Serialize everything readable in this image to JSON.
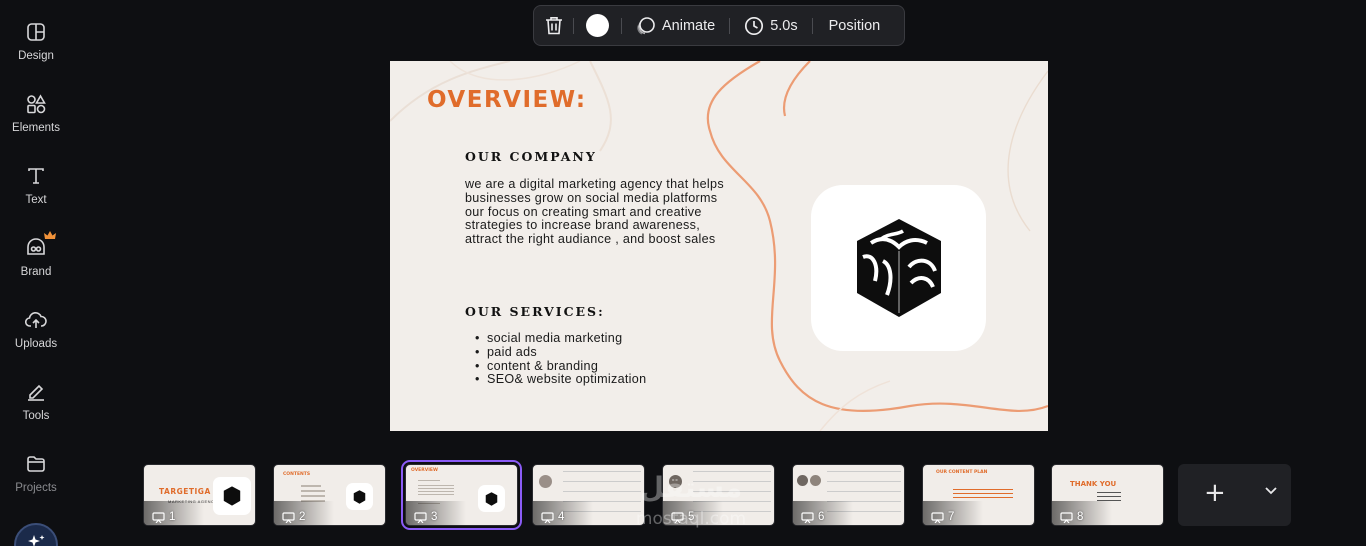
{
  "sidebar": {
    "items": [
      {
        "label": "Design",
        "icon": "design-icon"
      },
      {
        "label": "Elements",
        "icon": "elements-icon"
      },
      {
        "label": "Text",
        "icon": "text-icon"
      },
      {
        "label": "Brand",
        "icon": "brand-icon"
      },
      {
        "label": "Uploads",
        "icon": "uploads-icon"
      },
      {
        "label": "Tools",
        "icon": "tools-icon"
      },
      {
        "label": "Projects",
        "icon": "projects-icon"
      }
    ]
  },
  "toolbar": {
    "animate_label": "Animate",
    "duration_label": "5.0s",
    "position_label": "Position"
  },
  "slide": {
    "title": "OVERVIEW:",
    "company_heading": "OUR COMPANY",
    "company_text_1": "we are a digital marketing agency that helps businesses grow on social media platforms",
    "company_text_2": "our focus on creating smart and creative strategies to increase brand awareness, attract the right audiance , and boost sales",
    "services_heading": "OUR SERVICES:",
    "services": [
      "social media marketing",
      "paid ads",
      "content & branding",
      "SEO& website optimization"
    ]
  },
  "filmstrip": {
    "pages": [
      {
        "num": "1",
        "title": "TARGETIGA",
        "subtitle": "MARKETING AGENCY"
      },
      {
        "num": "2",
        "title": "CONTENTS"
      },
      {
        "num": "3",
        "title": "OVERVIEW"
      },
      {
        "num": "4"
      },
      {
        "num": "5"
      },
      {
        "num": "6"
      },
      {
        "num": "7",
        "title": "OUR CONTENT PLAN"
      },
      {
        "num": "8",
        "title": "THANK YOU"
      }
    ],
    "active_page": "3"
  },
  "watermark": {
    "line1": "مستقل",
    "line2": "mostaql.com"
  },
  "colors": {
    "accent": "#e06c2b",
    "selection": "#8b5cf6",
    "background": "#0e0f12",
    "slide_bg": "#f2eeea"
  }
}
